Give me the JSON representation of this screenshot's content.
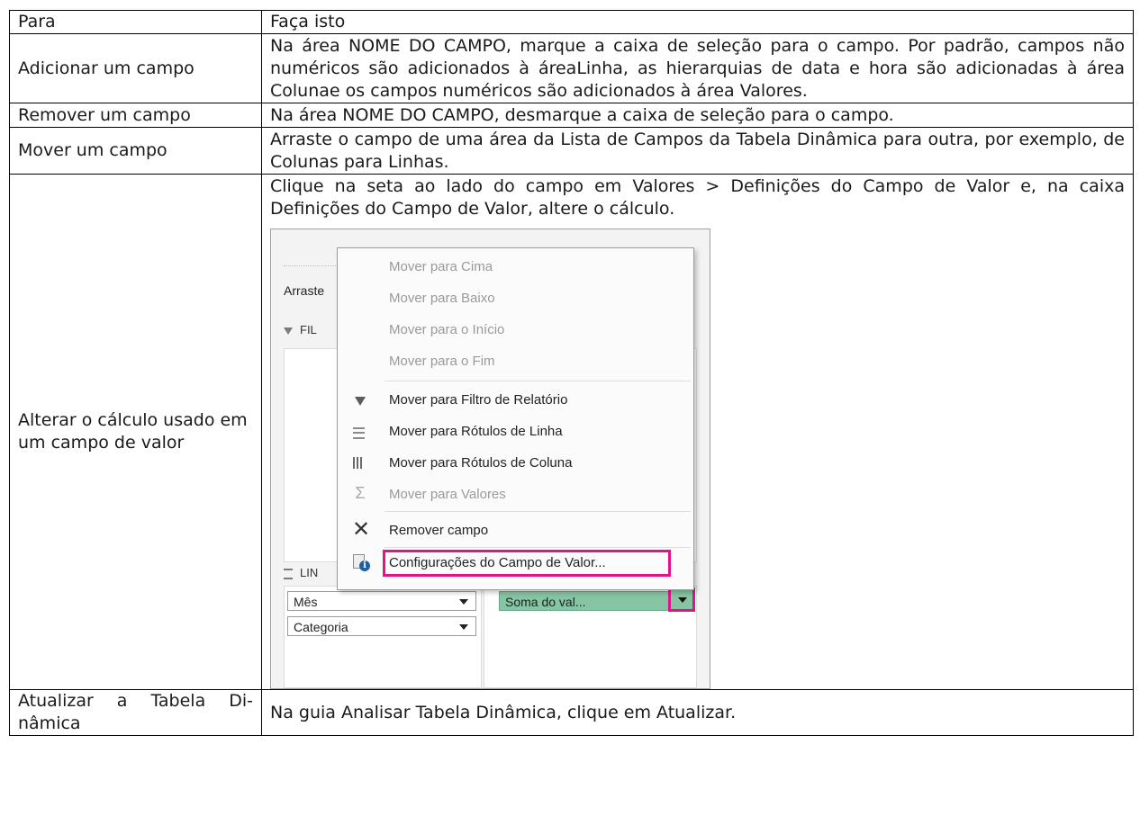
{
  "header": {
    "col1": "Para",
    "col2": "Faça isto"
  },
  "rows": [
    {
      "para": "Adicionar um campo",
      "faca": "Na área NOME DO CAMPO, marque a caixa de seleção para o campo. Por padrão, campos não numéricos são adicionados à áreaLinha, as hierarquias de data e hora são adicionadas à área Colunae os campos numéricos são adicionados à área Valores."
    },
    {
      "para": "Remover um campo",
      "faca": "Na área NOME DO CAMPO, desmarque a caixa de seleção para o campo."
    },
    {
      "para": "Mover um campo",
      "faca": "Arraste o campo de uma área da Lista de Campos da Tabela Dinâmica para outra, por exemplo, de Colunas para Linhas."
    },
    {
      "para": "Alterar o cálculo usado em um campo de valor",
      "faca": "Clique na seta ao lado do campo em Valores > Definições do Campo de Valor e, na caixa Definições do Campo de Valor, altere o cálculo."
    },
    {
      "para": "Atualizar a Tabela Di- nâmica",
      "faca": "Na guia Analisar Tabela Dinâmica, clique em Atualizar."
    }
  ],
  "screenshot": {
    "pane_label_arraste": "Arraste",
    "pane_label_filters": "FIL",
    "pane_label_rows": "LIN",
    "row_fields": [
      "Mês",
      "Categoria"
    ],
    "value_field": "Soma do val...",
    "menu": {
      "items": [
        {
          "label": "Mover para Cima",
          "enabled": false,
          "icon": "none"
        },
        {
          "label": "Mover para Baixo",
          "enabled": false,
          "icon": "none"
        },
        {
          "label": "Mover para o Início",
          "enabled": false,
          "icon": "none"
        },
        {
          "label": "Mover para o Fim",
          "enabled": false,
          "icon": "none"
        },
        {
          "label": "Mover para Filtro de Relatório",
          "enabled": true,
          "icon": "filter-icon"
        },
        {
          "label": "Mover para Rótulos de Linha",
          "enabled": true,
          "icon": "row-labels-icon"
        },
        {
          "label": "Mover para Rótulos de Coluna",
          "enabled": true,
          "icon": "column-labels-icon"
        },
        {
          "label": "Mover para Valores",
          "enabled": false,
          "icon": "sigma-icon"
        },
        {
          "label": "Remover campo",
          "enabled": true,
          "icon": "close-icon"
        },
        {
          "label": "Configurações do Campo de Valor...",
          "enabled": true,
          "icon": "field-settings-icon"
        }
      ]
    },
    "highlight_color": "#e3138c",
    "value_field_color": "#86c5a3"
  }
}
